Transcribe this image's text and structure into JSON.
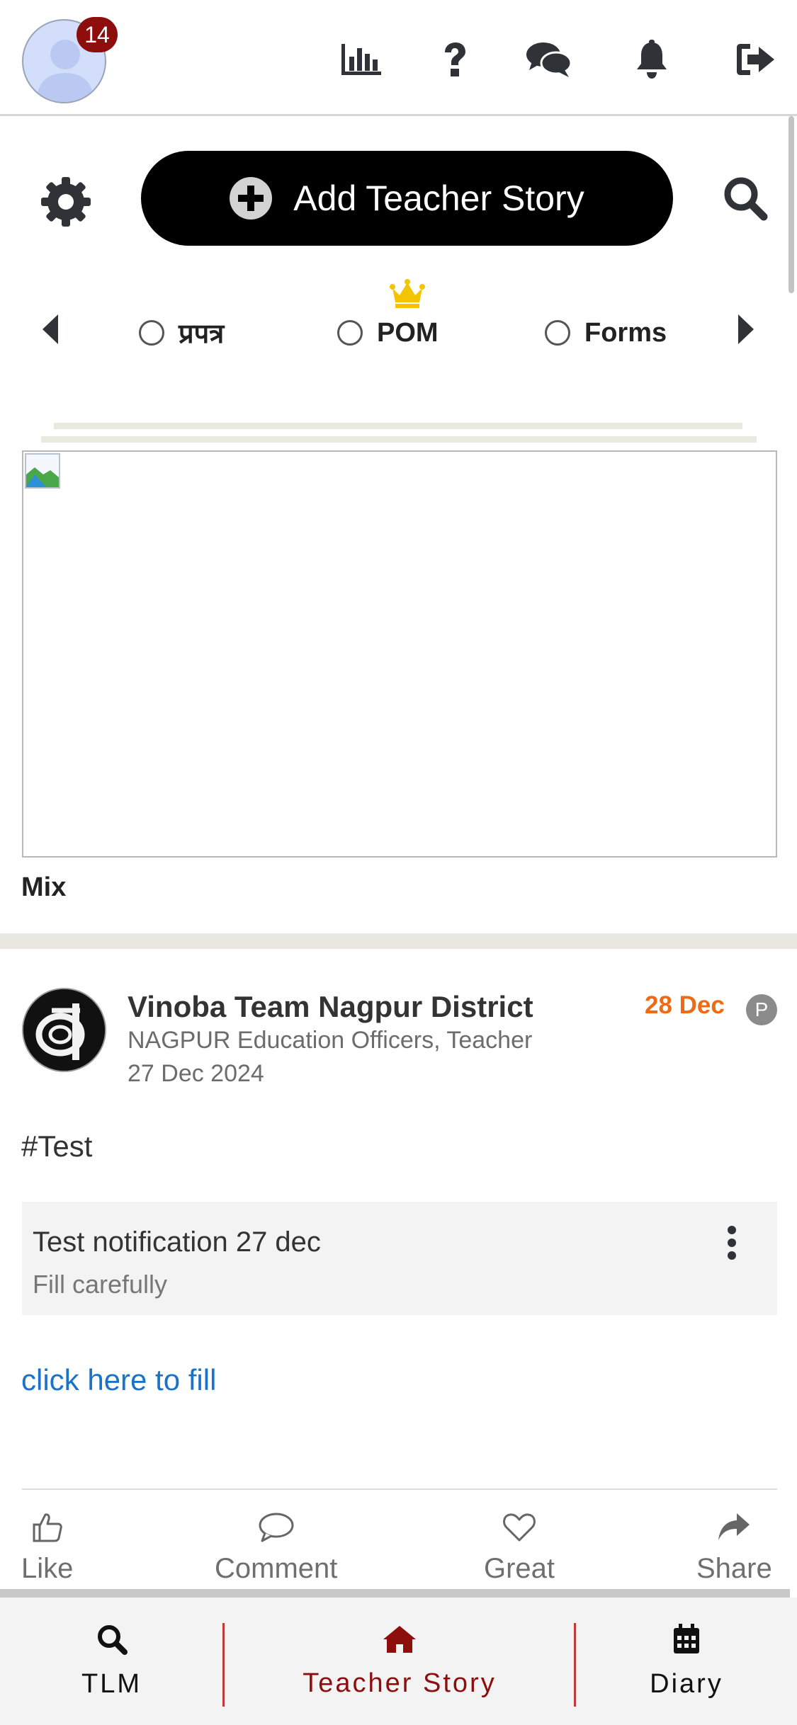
{
  "header": {
    "notification_count": "14",
    "icons": [
      "stats-icon",
      "help-icon",
      "chat-icon",
      "bell-icon",
      "logout-icon"
    ]
  },
  "actions": {
    "add_story_label": "Add Teacher Story"
  },
  "categories": [
    {
      "label": "प्रपत्र",
      "selected": false
    },
    {
      "label": "POM",
      "selected": false,
      "crown": true
    },
    {
      "label": "Forms",
      "selected": false
    }
  ],
  "banner": {
    "caption": "Mix"
  },
  "post": {
    "author": "Vinoba Team Nagpur District",
    "org": "NAGPUR Education Officers, Teacher",
    "date": "27 Dec 2024",
    "date_tag": "28 Dec",
    "privacy_badge": "P",
    "hashtag": "#Test",
    "notification": {
      "title": "Test notification 27 dec",
      "subtitle": "Fill carefully"
    },
    "link_text": "click here to fill",
    "reactions": {
      "like": "Like",
      "comment": "Comment",
      "great": "Great",
      "share": "Share"
    }
  },
  "bottom_nav": {
    "items": [
      {
        "label": "TLM",
        "icon": "search-icon"
      },
      {
        "label": "Teacher Story",
        "icon": "home-icon",
        "active": true
      },
      {
        "label": "Diary",
        "icon": "calendar-icon"
      }
    ]
  },
  "colors": {
    "badge": "#8e0d0d",
    "date_tag": "#f06a13",
    "link": "#1a73c9",
    "active_nav": "#8e0d0d",
    "crown": "#f5c400"
  }
}
